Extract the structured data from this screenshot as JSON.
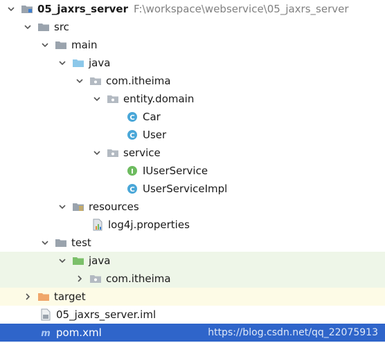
{
  "project": {
    "name": "05_jaxrs_server",
    "path": "F:\\workspace\\webservice\\05_jaxrs_server"
  },
  "tree": {
    "src": "src",
    "main": "main",
    "main_java": "java",
    "main_pkg": "com.itheima",
    "entity_pkg": "entity.domain",
    "class_car": "Car",
    "class_user": "User",
    "service_pkg": "service",
    "iface_iuserservice": "IUserService",
    "class_userserviceimpl": "UserServiceImpl",
    "resources": "resources",
    "log4j": "log4j.properties",
    "test": "test",
    "test_java": "java",
    "test_pkg": "com.itheima",
    "target": "target",
    "iml": "05_jaxrs_server.iml",
    "pom": "pom.xml"
  },
  "watermark": "https://blog.csdn.net/qq_22075913",
  "colors": {
    "selection": "#2f65ca",
    "test_background": "#eef6e8",
    "excluded_background": "#fdfbe6",
    "folder_gray": "#9aa3ad",
    "folder_blue": "#8cc8ea",
    "folder_green": "#7cc06a",
    "folder_orange": "#f0a66a",
    "class_icon": "#4aa7d8",
    "interface_icon": "#6dbb5f"
  }
}
